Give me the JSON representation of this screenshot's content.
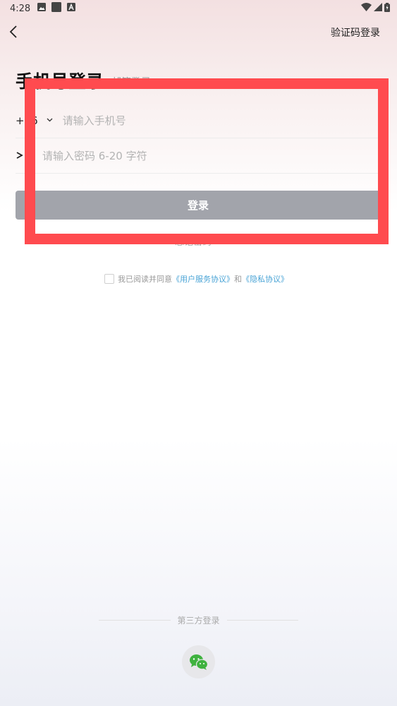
{
  "status_bar": {
    "time": "4:28"
  },
  "header": {
    "back_label": "‹",
    "switch_mode_link": "验证码登录"
  },
  "title": {
    "main": "手机号登录",
    "alt": "邮箱登录"
  },
  "form": {
    "country_code": "+86",
    "phone_placeholder": "请输入手机号",
    "password_placeholder": "请输入密码 6-20 字符",
    "login_button": "登录",
    "forgot_link": "忘记密码"
  },
  "agreement": {
    "prefix": "我已阅读并同意",
    "user_agreement": "《用户服务协议》",
    "and": "和",
    "privacy_agreement": "《隐私协议》"
  },
  "third_party": {
    "label": "第三方登录",
    "icons": [
      "wechat-icon"
    ]
  },
  "colors": {
    "highlight_border": "#ff4b4f",
    "button_disabled": "#a2a4ab",
    "link": "#4aa4d6",
    "wechat_green": "#3fb23f"
  }
}
